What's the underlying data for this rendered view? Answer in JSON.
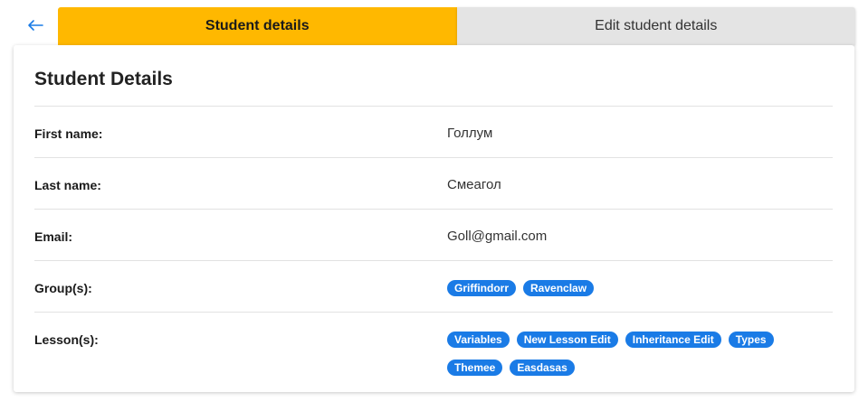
{
  "header": {
    "back_icon": "arrow-left-icon",
    "accent_color": "#1a7be6"
  },
  "tabs": [
    {
      "label": "Student details",
      "active": true
    },
    {
      "label": "Edit student details",
      "active": false
    }
  ],
  "card": {
    "title": "Student Details",
    "first_name": {
      "label": "First name:",
      "value": "Голлум"
    },
    "last_name": {
      "label": "Last name:",
      "value": "Смеагол"
    },
    "email": {
      "label": "Email:",
      "value": "Goll@gmail.com"
    },
    "groups": {
      "label": "Group(s):",
      "items": [
        "Griffindorr",
        "Ravenclaw"
      ]
    },
    "lessons": {
      "label": "Lesson(s):",
      "items": [
        "Variables",
        "New Lesson Edit",
        "Inheritance Edit",
        "Types",
        "Themee",
        "Easdasas"
      ]
    }
  },
  "colors": {
    "tab_active": "#ffb800",
    "tab_inactive": "#e4e4e4",
    "chip": "#1a7be6"
  }
}
